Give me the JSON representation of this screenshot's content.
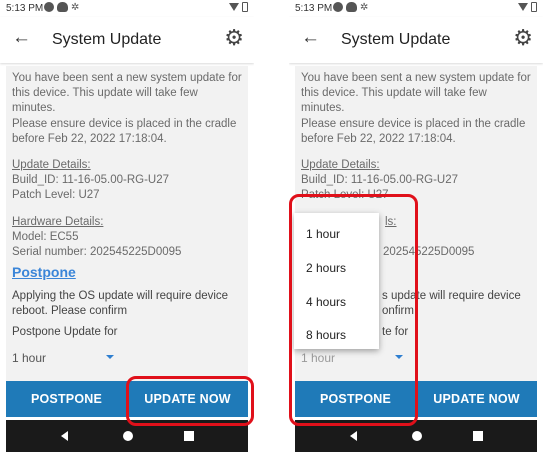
{
  "status": {
    "time": "5:13 PM"
  },
  "appbar": {
    "title": "System Update",
    "back_icon": "arrow-left-icon",
    "settings_icon": "gear-icon"
  },
  "content": {
    "intro": "You have been sent a new system update for this device. This update will take few minutes.",
    "cradle": "Please ensure device is placed in the cradle before Feb 22, 2022 17:18:04.",
    "update_details_label": "Update Details:",
    "build_id": "Build_ID: 11-16-05.00-RG-U27",
    "patch_level": "Patch Level: U27",
    "hardware_details_label": "Hardware Details:",
    "model": "Model: EC55",
    "serial": "Serial number: 202545225D0095",
    "postpone_link": "Postpone",
    "reboot_note": "Applying the OS update will require device reboot. Please confirm",
    "postpone_for_label": "Postpone Update for",
    "selected_duration": "1 hour"
  },
  "right_partial": {
    "intro": "You have been sent a new system update for this device. This update will take few minutes.",
    "cradle": "Please ensure device is placed in the cradle before Feb 22, 2022 17:18:04.",
    "update_details_label": "Update Details:",
    "build_id": "Build_ID: 11-16-05.00-RG-U27",
    "patch_level": "Patch Level: U27",
    "hw_frag": "ls:",
    "serial_frag": "202545225D0095",
    "reboot_frag1": "s update will require device",
    "reboot_frag2": "onfirm",
    "postpone_frag": "te for"
  },
  "dropdown": {
    "options": [
      "1 hour",
      "2 hours",
      "4 hours",
      "8 hours"
    ]
  },
  "buttons": {
    "postpone": "POSTPONE",
    "update_now": "UPDATE NOW"
  },
  "colors": {
    "accent": "#1f7ab8",
    "link": "#3a85d8",
    "highlight": "#e0101a"
  }
}
